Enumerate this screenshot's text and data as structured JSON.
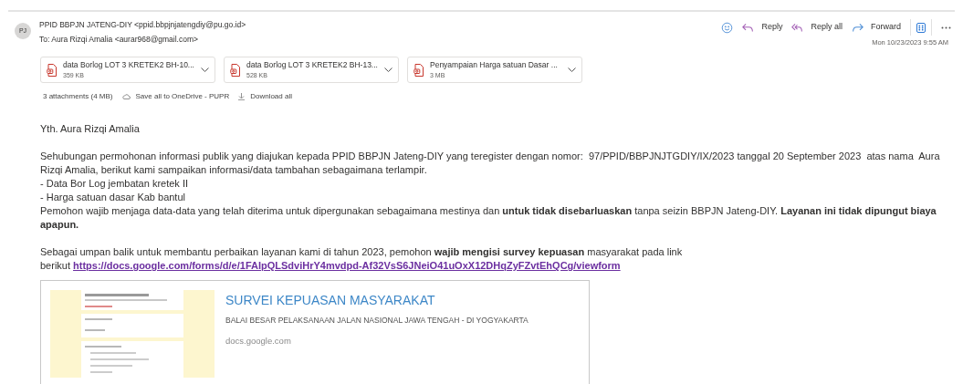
{
  "header": {
    "avatar": "PJ",
    "from": "PPID BBPJN JATENG-DIY <ppid.bbpjnjatengdiy@pu.go.id>",
    "to": "To: Aura Rizqi Amalia <aurar968@gmail.com>",
    "date": "Mon 10/23/2023 9:55 AM"
  },
  "actions": [
    {
      "kind": "emoji"
    },
    {
      "kind": "reply",
      "label": "Reply"
    },
    {
      "kind": "reply_all",
      "label": "Reply all"
    },
    {
      "kind": "forward",
      "label": "Forward"
    },
    {
      "kind": "apps"
    },
    {
      "kind": "more"
    }
  ],
  "attachments": [
    {
      "name": "data Borlog LOT 3 KRETEK2 BH-10...",
      "size": "359 KB"
    },
    {
      "name": "data Borlog LOT 3 KRETEK2 BH-13...",
      "size": "528 KB"
    },
    {
      "name": "Penyampaian Harga satuan Dasar ...",
      "size": "3 MB"
    }
  ],
  "attachment_bar": {
    "summary": "3 attachments (4 MB)",
    "save_all": "Save all to OneDrive - PUPR",
    "download_all": "Download all"
  },
  "body": {
    "greeting": "Yth. Aura Rizqi Amalia",
    "paragraph_1": [
      "Sehubungan permohonan informasi publik yang diajukan kepada PPID BBPJN Jateng-DIY yang teregister dengan nomor:  97/PPID/BBPJNJTGDIY/IX/2023 tanggal 20 September 2023  atas nama  Aura Rizqi Amalia, berikut kami sampaikan informasi/data tambahan sebagaimana terlampir.",
      "- Data Bor Log jembatan kretek II",
      "- Harga satuan dasar Kab bantul",
      "Pemohon wajib menjaga data-data yang telah diterima untuk dipergunakan sebagaimana mestinya dan **untuk tidak disebarluaskan** tanpa seizin BBPJN Jateng-DIY. **Layanan ini tidak dipungut biaya apapun.**"
    ],
    "paragraph_2": "Sebagai umpan balik untuk membantu perbaikan layanan kami di tahun 2023, pemohon **wajib mengisi survey kepuasan** masyarakat pada link",
    "link_prefix": "berikut",
    "link": "https://docs.google.com/forms/d/e/1FAIpQLSdviHrY4mvdpd-Af32VsS6JNeiO41uOxX12DHqZyFZvtEhQCg/viewform"
  },
  "link_preview": {
    "title": "SURVEI KEPUASAN MASYARAKAT",
    "subtitle": "BALAI BESAR PELAKSANAAN JALAN NASIONAL JAWA TENGAH - DI YOGYAKARTA",
    "domain": "docs.google.com"
  }
}
